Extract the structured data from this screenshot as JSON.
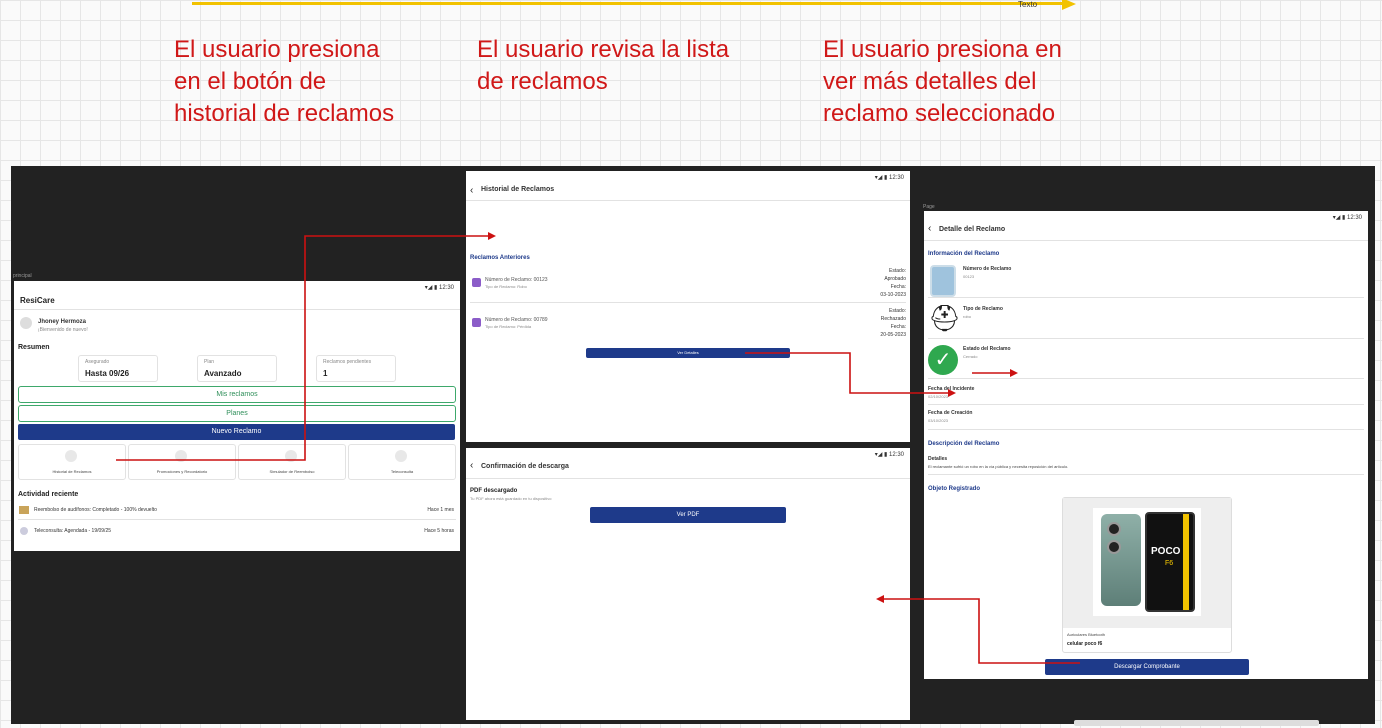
{
  "top_bar": {
    "label": "Texto"
  },
  "captions": [
    "El usuario presiona en el botón de historial de reclamos",
    "El usuario revisa la lista de reclamos",
    "El usuario presiona en ver más detalles del reclamo seleccionado"
  ],
  "frame_labels": {
    "principal": "principal",
    "page": "Page"
  },
  "status_time": "12:30",
  "screen1": {
    "app_title": "ResiCare",
    "user_name": "Jhoney Hermoza",
    "user_sub": "¡Bienvenido de nuevo!",
    "summary_title": "Resumen",
    "summary": [
      {
        "label": "Asegurado",
        "value": "Hasta 09/26"
      },
      {
        "label": "Plan",
        "value": "Avanzado"
      },
      {
        "label": "Reclamos pendientes",
        "value": "1"
      }
    ],
    "btn_mis_reclamos": "Mis reclamos",
    "btn_planes": "Planes",
    "btn_nuevo_reclamo": "Nuevo Reclamo",
    "shortcuts": [
      "Historial de Reclamos",
      "Promociones y Recordatorio",
      "Simulador de Reembolso",
      "Teleconsulta"
    ],
    "activity_title": "Actividad reciente",
    "activity": [
      {
        "text": "Reembolso de audífonos: Completado - 100% devuelto",
        "time": "Hace 1 mes"
      },
      {
        "text": "Teleconsulta: Agendada - 19/09/25",
        "time": "Hace 5 horas"
      }
    ]
  },
  "screen2": {
    "header": "Historial de Reclamos",
    "section_title": "Reclamos Anteriores",
    "claims": [
      {
        "title": "Número de Reclamo: 00123",
        "sub": "Tipo de Reclamo: Robo",
        "status_label": "Estado:",
        "status": "Aprobado",
        "date_label": "Fecha:",
        "date": "03-10-2023"
      },
      {
        "title": "Número de Reclamo: 00789",
        "sub": "Tipo de Reclamo: Pérdida",
        "status_label": "Estado:",
        "status": "Rechazado",
        "date_label": "Fecha:",
        "date": "20-05-2023"
      }
    ],
    "btn_details": "Ver Detalles"
  },
  "screen3": {
    "header": "Confirmación de descarga",
    "title": "PDF descargado",
    "sub": "Tu PDF ahora está guardado en tu dispositivo",
    "btn": "Ver PDF"
  },
  "screen4": {
    "header": "Detalle del Reclamo",
    "section_info": "Información del Reclamo",
    "num_label": "Número de Reclamo",
    "num_value": "00123",
    "type_label": "Tipo de Reclamo",
    "type_value": "robo",
    "state_label": "Estado del Reclamo",
    "state_value": "Cerrado",
    "incident_label": "Fecha del Incidente",
    "incident_value": "02/10/2023",
    "created_label": "Fecha de Creación",
    "created_value": "03/10/2023",
    "desc_title": "Descripción del Reclamo",
    "desc_sub": "Detalles",
    "desc_text": "El reclamante sufrió un robo en la vía pública y necesita reposición del artículo.",
    "object_title": "Objeto Registrado",
    "phone_brand": "POCO",
    "phone_model": "F6",
    "object_caption": "Auriculares Bluetooth",
    "object_name": "celular  poco f6",
    "btn_download": "Descargar Comprobante"
  },
  "colors": {
    "caption": "#d01818",
    "navy": "#1e3a8a",
    "green": "#2fa84f",
    "arrow": "#cc1111",
    "yellow": "#f2c200"
  }
}
